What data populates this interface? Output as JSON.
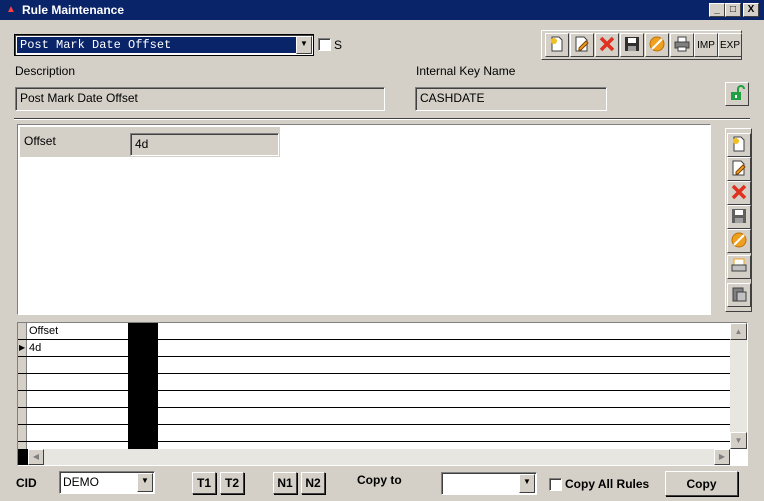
{
  "window": {
    "title": "Rule Maintenance",
    "controls": {
      "minimize": "_",
      "maximize": "□",
      "close": "X"
    }
  },
  "rule_selector": {
    "selected": "Post Mark Date Offset",
    "s_checkbox_label": "S"
  },
  "toolbar": {
    "imp_label": "IMP",
    "exp_label": "EXP",
    "icons": [
      "new-icon",
      "edit-icon",
      "delete-icon",
      "save-icon",
      "cancel-icon",
      "print-icon"
    ]
  },
  "description": {
    "label": "Description",
    "value": "Post Mark Date Offset"
  },
  "internal_key": {
    "label": "Internal Key Name",
    "value": "CASHDATE"
  },
  "detail": {
    "offset_label": "Offset",
    "offset_value": "4d"
  },
  "side_toolbar": {
    "icons": [
      "new-icon",
      "edit-icon",
      "delete-icon",
      "save-icon",
      "cancel-icon",
      "print-icon",
      "paste-icon"
    ]
  },
  "grid": {
    "columns": [
      "Offset"
    ],
    "rows": [
      [
        "4d"
      ],
      [
        ""
      ],
      [
        ""
      ],
      [
        ""
      ],
      [
        ""
      ],
      [
        ""
      ]
    ]
  },
  "footer": {
    "cid_label": "CID",
    "cid_value": "DEMO",
    "t1": "T1",
    "t2": "T2",
    "n1": "N1",
    "n2": "N2",
    "copy_to_label": "Copy to",
    "copy_to_value": "",
    "copy_all_label": "Copy All Rules",
    "copy_button": "Copy"
  },
  "colors": {
    "title_bar": "#0a246a",
    "face": "#d4d0c8",
    "selection": "#0a246a",
    "delete_red": "#e03020",
    "cancel_orange": "#f0a020",
    "lock_green": "#20a040"
  }
}
